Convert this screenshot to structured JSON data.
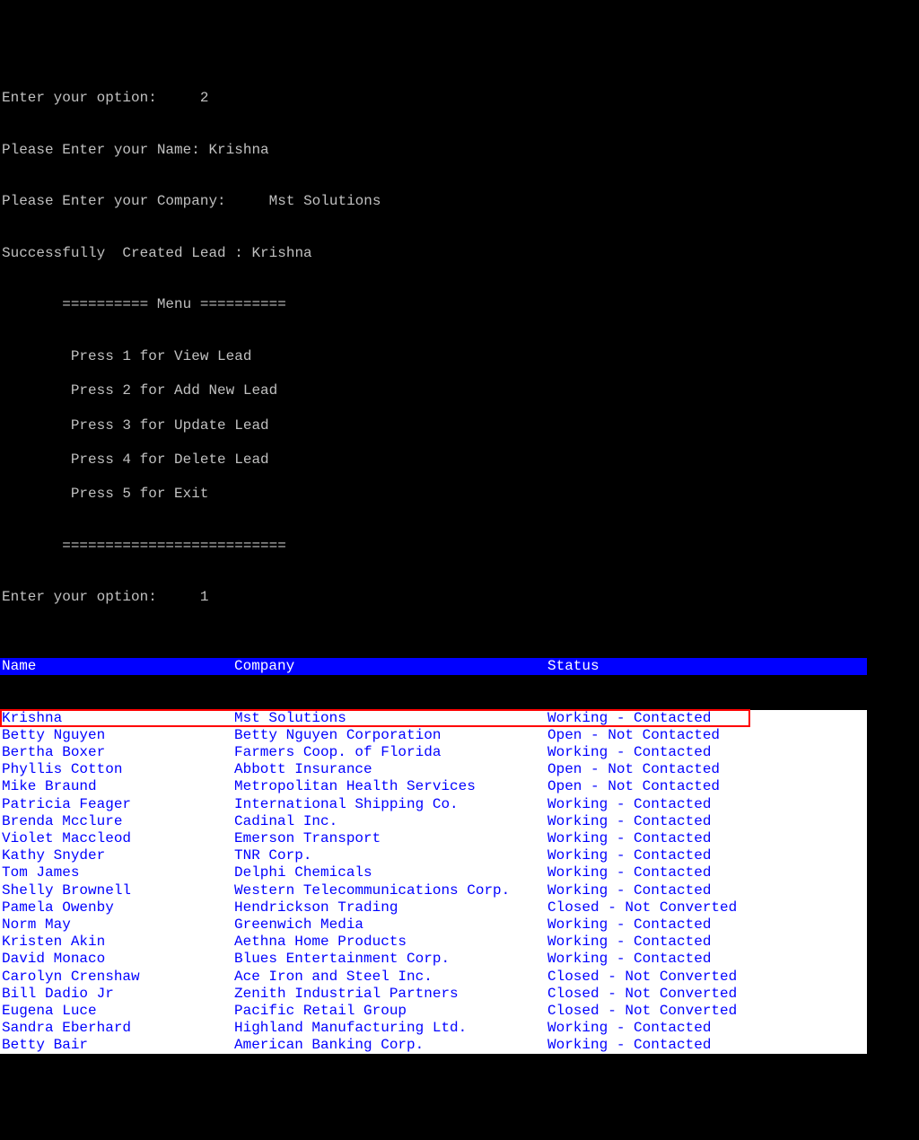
{
  "terminal": {
    "prompt1_label": "Enter your option:     ",
    "prompt1_value": "2",
    "blank": "",
    "name_prompt_label": "Please Enter your Name: ",
    "name_prompt_value": "Krishna",
    "company_prompt_label": "Please Enter your Company:     ",
    "company_prompt_value": "Mst Solutions",
    "success_msg": "Successfully  Created Lead : Krishna",
    "menu_header": "       ========== Menu ==========",
    "menu_items": [
      "        Press 1 for View Lead",
      "        Press 2 for Add New Lead",
      "        Press 3 for Update Lead",
      "        Press 4 for Delete Lead",
      "        Press 5 for Exit"
    ],
    "menu_footer": "       ==========================",
    "prompt2_label": "Enter your option:     ",
    "prompt2_value": "1"
  },
  "table": {
    "headers": {
      "name": "Name",
      "company": "Company",
      "status": "Status"
    },
    "rows": [
      {
        "name": "Krishna",
        "company": "Mst Solutions",
        "status": "Working - Contacted",
        "highlight": true
      },
      {
        "name": "Betty Nguyen",
        "company": "Betty Nguyen Corporation",
        "status": "Open - Not Contacted"
      },
      {
        "name": "Bertha Boxer",
        "company": "Farmers Coop. of Florida",
        "status": "Working - Contacted"
      },
      {
        "name": "Phyllis Cotton",
        "company": "Abbott Insurance",
        "status": "Open - Not Contacted"
      },
      {
        "name": "Mike Braund",
        "company": "Metropolitan Health Services",
        "status": "Open - Not Contacted"
      },
      {
        "name": "Patricia Feager",
        "company": "International Shipping Co.",
        "status": "Working - Contacted"
      },
      {
        "name": "Brenda Mcclure",
        "company": "Cadinal Inc.",
        "status": "Working - Contacted"
      },
      {
        "name": "Violet Maccleod",
        "company": "Emerson Transport",
        "status": "Working - Contacted"
      },
      {
        "name": "Kathy Snyder",
        "company": "TNR Corp.",
        "status": "Working - Contacted"
      },
      {
        "name": "Tom James",
        "company": "Delphi Chemicals",
        "status": "Working - Contacted"
      },
      {
        "name": "Shelly Brownell",
        "company": "Western Telecommunications Corp.",
        "status": "Working - Contacted"
      },
      {
        "name": "Pamela Owenby",
        "company": "Hendrickson Trading",
        "status": "Closed - Not Converted"
      },
      {
        "name": "Norm May",
        "company": "Greenwich Media",
        "status": "Working - Contacted"
      },
      {
        "name": "Kristen Akin",
        "company": "Aethna Home Products",
        "status": "Working - Contacted"
      },
      {
        "name": "David Monaco",
        "company": "Blues Entertainment Corp.",
        "status": "Working - Contacted"
      },
      {
        "name": "Carolyn Crenshaw",
        "company": "Ace Iron and Steel Inc.",
        "status": "Closed - Not Converted"
      },
      {
        "name": "Bill Dadio Jr",
        "company": "Zenith Industrial Partners",
        "status": "Closed - Not Converted"
      },
      {
        "name": "Eugena Luce",
        "company": "Pacific Retail Group",
        "status": "Closed - Not Converted"
      },
      {
        "name": "Sandra Eberhard",
        "company": "Highland Manufacturing Ltd.",
        "status": "Working - Contacted"
      },
      {
        "name": "Betty Bair",
        "company": "American Banking Corp.",
        "status": "Working - Contacted"
      }
    ]
  }
}
